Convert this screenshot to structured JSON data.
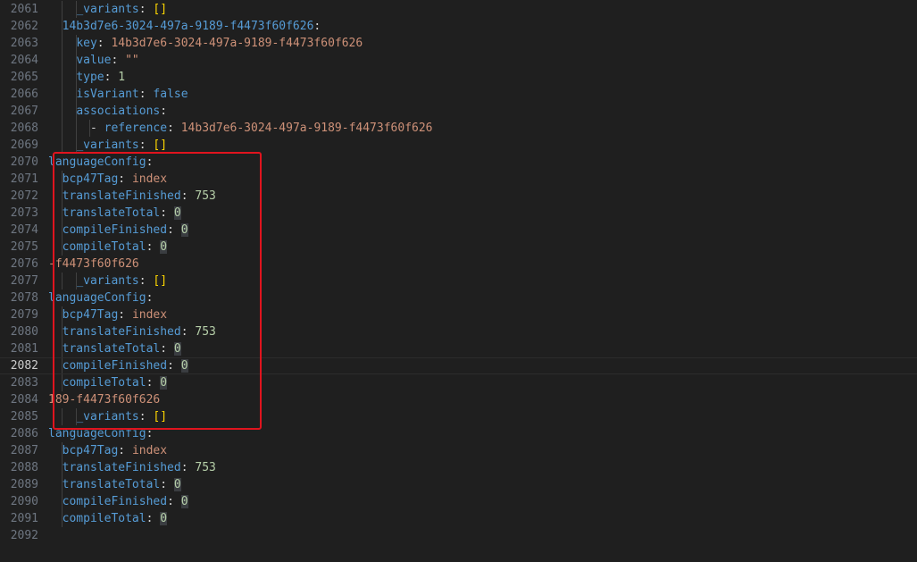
{
  "editor": {
    "current_line": 2082,
    "lines": [
      {
        "num": "2061",
        "tokens": [
          {
            "t": "    "
          },
          {
            "t": "_variants",
            "c": "k"
          },
          {
            "t": ": ",
            "c": "p"
          },
          {
            "t": "[]",
            "c": "br"
          }
        ]
      },
      {
        "num": "2062",
        "tokens": [
          {
            "t": "  "
          },
          {
            "t": "14b3d7e6-3024-497a-9189-f4473f60f626",
            "c": "k"
          },
          {
            "t": ":",
            "c": "p"
          }
        ]
      },
      {
        "num": "2063",
        "tokens": [
          {
            "t": "    "
          },
          {
            "t": "key",
            "c": "k"
          },
          {
            "t": ": ",
            "c": "p"
          },
          {
            "t": "14b3d7e6-3024-497a-9189-f4473f60f626",
            "c": "s"
          }
        ]
      },
      {
        "num": "2064",
        "tokens": [
          {
            "t": "    "
          },
          {
            "t": "value",
            "c": "k"
          },
          {
            "t": ": ",
            "c": "p"
          },
          {
            "t": "\"\"",
            "c": "s"
          }
        ]
      },
      {
        "num": "2065",
        "tokens": [
          {
            "t": "    "
          },
          {
            "t": "type",
            "c": "k"
          },
          {
            "t": ": ",
            "c": "p"
          },
          {
            "t": "1",
            "c": "n"
          }
        ]
      },
      {
        "num": "2066",
        "tokens": [
          {
            "t": "    "
          },
          {
            "t": "isVariant",
            "c": "k"
          },
          {
            "t": ": ",
            "c": "p"
          },
          {
            "t": "false",
            "c": "b"
          }
        ]
      },
      {
        "num": "2067",
        "tokens": [
          {
            "t": "    "
          },
          {
            "t": "associations",
            "c": "k"
          },
          {
            "t": ":",
            "c": "p"
          }
        ]
      },
      {
        "num": "2068",
        "tokens": [
          {
            "t": "      "
          },
          {
            "t": "- ",
            "c": "p"
          },
          {
            "t": "reference",
            "c": "k"
          },
          {
            "t": ": ",
            "c": "p"
          },
          {
            "t": "14b3d7e6-3024-497a-9189-f4473f60f626",
            "c": "s"
          }
        ]
      },
      {
        "num": "2069",
        "tokens": [
          {
            "t": "    "
          },
          {
            "t": "_variants",
            "c": "k"
          },
          {
            "t": ": ",
            "c": "p"
          },
          {
            "t": "[]",
            "c": "br"
          }
        ]
      },
      {
        "num": "2070",
        "tokens": [
          {
            "t": "languageConfig",
            "c": "k"
          },
          {
            "t": ":",
            "c": "p"
          }
        ]
      },
      {
        "num": "2071",
        "tokens": [
          {
            "t": "  "
          },
          {
            "t": "bcp47Tag",
            "c": "k"
          },
          {
            "t": ": ",
            "c": "p"
          },
          {
            "t": "index",
            "c": "s"
          }
        ]
      },
      {
        "num": "2072",
        "tokens": [
          {
            "t": "  "
          },
          {
            "t": "translateFinished",
            "c": "k"
          },
          {
            "t": ": ",
            "c": "p"
          },
          {
            "t": "753",
            "c": "n"
          }
        ]
      },
      {
        "num": "2073",
        "tokens": [
          {
            "t": "  "
          },
          {
            "t": "translateTotal",
            "c": "k"
          },
          {
            "t": ": ",
            "c": "p"
          },
          {
            "t": "0",
            "c": "z"
          }
        ]
      },
      {
        "num": "2074",
        "tokens": [
          {
            "t": "  "
          },
          {
            "t": "compileFinished",
            "c": "k"
          },
          {
            "t": ": ",
            "c": "p"
          },
          {
            "t": "0",
            "c": "z"
          }
        ]
      },
      {
        "num": "2075",
        "tokens": [
          {
            "t": "  "
          },
          {
            "t": "compileTotal",
            "c": "k"
          },
          {
            "t": ": ",
            "c": "p"
          },
          {
            "t": "0",
            "c": "z"
          }
        ]
      },
      {
        "num": "2076",
        "tokens": [
          {
            "t": "-f4473f60f626",
            "c": "s"
          }
        ]
      },
      {
        "num": "2077",
        "tokens": [
          {
            "t": "    "
          },
          {
            "t": "_variants",
            "c": "k"
          },
          {
            "t": ": ",
            "c": "p"
          },
          {
            "t": "[]",
            "c": "br"
          }
        ]
      },
      {
        "num": "2078",
        "tokens": [
          {
            "t": "languageConfig",
            "c": "k"
          },
          {
            "t": ":",
            "c": "p"
          }
        ]
      },
      {
        "num": "2079",
        "tokens": [
          {
            "t": "  "
          },
          {
            "t": "bcp47Tag",
            "c": "k"
          },
          {
            "t": ": ",
            "c": "p"
          },
          {
            "t": "index",
            "c": "s"
          }
        ]
      },
      {
        "num": "2080",
        "tokens": [
          {
            "t": "  "
          },
          {
            "t": "translateFinished",
            "c": "k"
          },
          {
            "t": ": ",
            "c": "p"
          },
          {
            "t": "753",
            "c": "n"
          }
        ]
      },
      {
        "num": "2081",
        "tokens": [
          {
            "t": "  "
          },
          {
            "t": "translateTotal",
            "c": "k"
          },
          {
            "t": ": ",
            "c": "p"
          },
          {
            "t": "0",
            "c": "z"
          }
        ]
      },
      {
        "num": "2082",
        "tokens": [
          {
            "t": "  "
          },
          {
            "t": "compileFinished",
            "c": "k"
          },
          {
            "t": ": ",
            "c": "p"
          },
          {
            "t": "0",
            "c": "z"
          }
        ]
      },
      {
        "num": "2083",
        "tokens": [
          {
            "t": "  "
          },
          {
            "t": "compileTotal",
            "c": "k"
          },
          {
            "t": ": ",
            "c": "p"
          },
          {
            "t": "0",
            "c": "z"
          }
        ]
      },
      {
        "num": "2084",
        "tokens": [
          {
            "t": "189-f4473f60f626",
            "c": "s"
          }
        ]
      },
      {
        "num": "2085",
        "tokens": [
          {
            "t": "    "
          },
          {
            "t": "_variants",
            "c": "k"
          },
          {
            "t": ": ",
            "c": "p"
          },
          {
            "t": "[]",
            "c": "br"
          }
        ]
      },
      {
        "num": "2086",
        "tokens": [
          {
            "t": "languageConfig",
            "c": "k"
          },
          {
            "t": ":",
            "c": "p"
          }
        ]
      },
      {
        "num": "2087",
        "tokens": [
          {
            "t": "  "
          },
          {
            "t": "bcp47Tag",
            "c": "k"
          },
          {
            "t": ": ",
            "c": "p"
          },
          {
            "t": "index",
            "c": "s"
          }
        ]
      },
      {
        "num": "2088",
        "tokens": [
          {
            "t": "  "
          },
          {
            "t": "translateFinished",
            "c": "k"
          },
          {
            "t": ": ",
            "c": "p"
          },
          {
            "t": "753",
            "c": "n"
          }
        ]
      },
      {
        "num": "2089",
        "tokens": [
          {
            "t": "  "
          },
          {
            "t": "translateTotal",
            "c": "k"
          },
          {
            "t": ": ",
            "c": "p"
          },
          {
            "t": "0",
            "c": "z"
          }
        ]
      },
      {
        "num": "2090",
        "tokens": [
          {
            "t": "  "
          },
          {
            "t": "compileFinished",
            "c": "k"
          },
          {
            "t": ": ",
            "c": "p"
          },
          {
            "t": "0",
            "c": "z"
          }
        ]
      },
      {
        "num": "2091",
        "tokens": [
          {
            "t": "  "
          },
          {
            "t": "compileTotal",
            "c": "k"
          },
          {
            "t": ": ",
            "c": "p"
          },
          {
            "t": "0",
            "c": "z"
          }
        ]
      },
      {
        "num": "2092",
        "tokens": []
      }
    ]
  },
  "colors": {
    "background": "#1f1f1f",
    "key": "#569cd6",
    "string": "#ce9178",
    "number": "#b5cea8",
    "bracket": "#ffd700",
    "annotation_box": "#e0141e"
  }
}
